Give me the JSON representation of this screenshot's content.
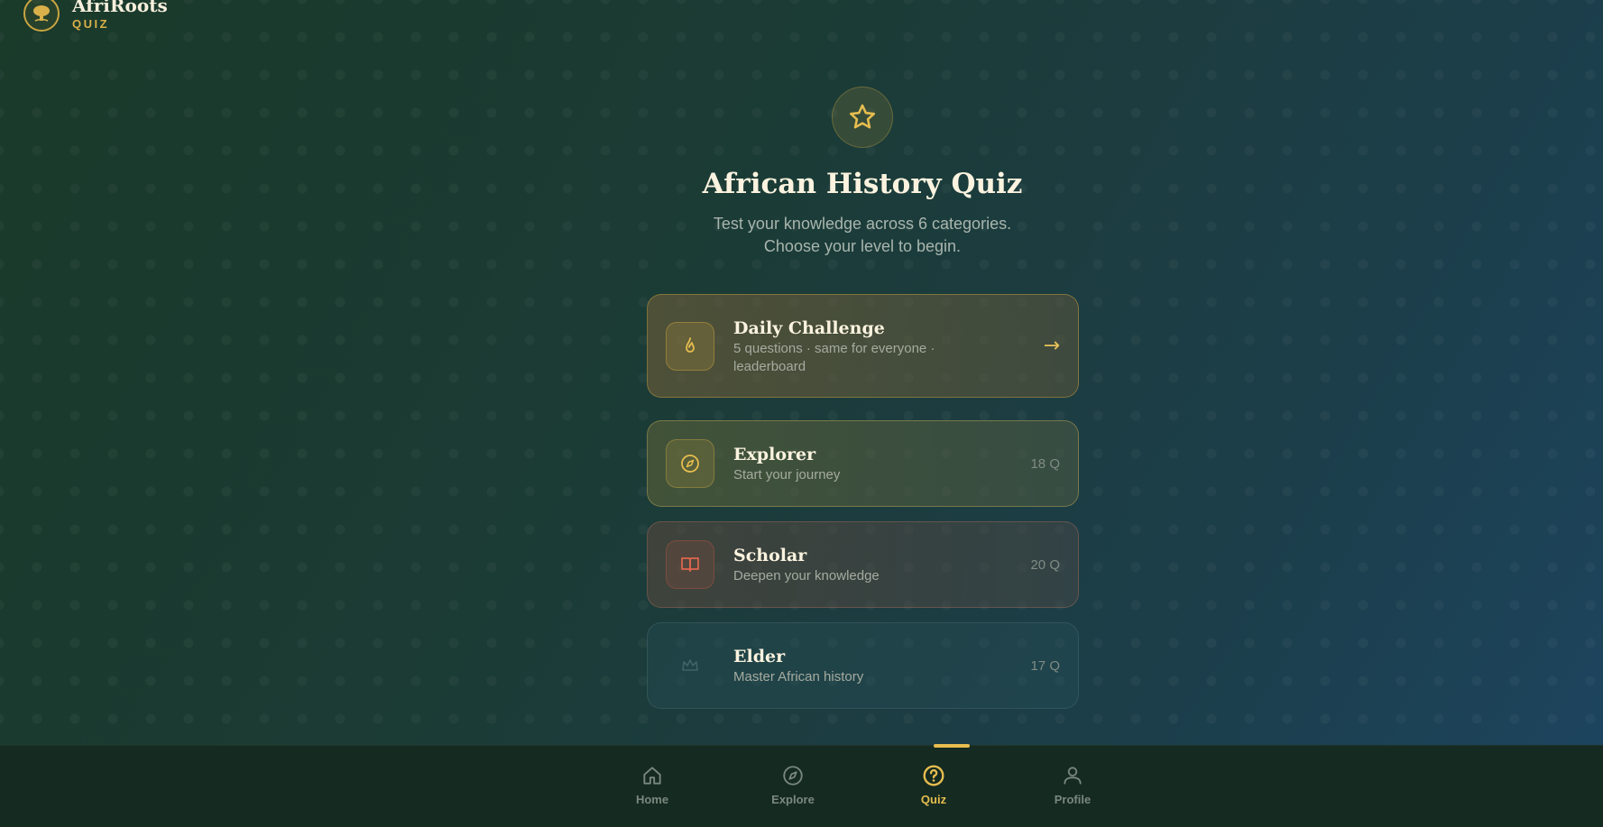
{
  "brand": {
    "name": "AfriRoots",
    "sub": "QUIZ"
  },
  "hero": {
    "icon": "star-icon",
    "title": "African History Quiz",
    "subtitle_line1": "Test your knowledge across 6 categories.",
    "subtitle_line2": "Choose your level to begin."
  },
  "cards": {
    "daily": {
      "icon": "flame-icon",
      "title": "Daily Challenge",
      "desc_line1": "5 questions · same for everyone ·",
      "desc_line2": "leaderboard",
      "arrow": "→"
    },
    "explorer": {
      "icon": "compass-icon",
      "title": "Explorer",
      "desc": "Start your journey",
      "meta": "18 Q"
    },
    "scholar": {
      "icon": "book-icon",
      "title": "Scholar",
      "desc": "Deepen your knowledge",
      "meta": "20 Q"
    },
    "elder": {
      "icon": "crown-icon",
      "title": "Elder",
      "desc": "Master African history",
      "meta": "17 Q"
    }
  },
  "nav": {
    "items": [
      {
        "label": "Home",
        "icon": "home-icon",
        "active": false
      },
      {
        "label": "Explore",
        "icon": "compass-icon",
        "active": false
      },
      {
        "label": "Quiz",
        "icon": "question-icon",
        "active": true
      },
      {
        "label": "Profile",
        "icon": "user-icon",
        "active": false
      }
    ]
  },
  "colors": {
    "accent": "#e6bd4f",
    "background": "#1b3b35",
    "nav_background": "#152a20"
  }
}
